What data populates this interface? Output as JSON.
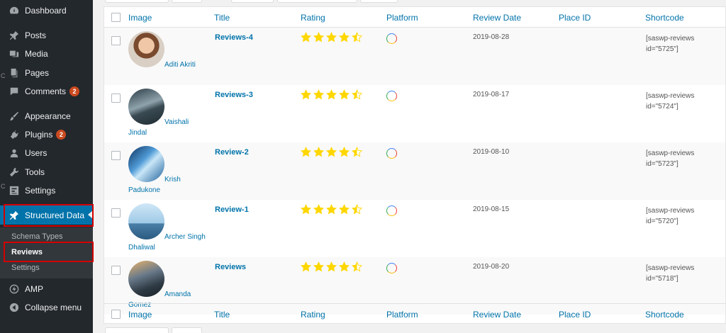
{
  "sidebar": {
    "items": [
      {
        "label": "Dashboard",
        "icon": "dashboard-icon"
      },
      {
        "label": "Posts",
        "icon": "pin-icon"
      },
      {
        "label": "Media",
        "icon": "media-icon"
      },
      {
        "label": "Pages",
        "icon": "pages-icon"
      },
      {
        "label": "Comments",
        "icon": "comments-icon",
        "badge": "2"
      },
      {
        "label": "Appearance",
        "icon": "paintbrush-icon"
      },
      {
        "label": "Plugins",
        "icon": "plugin-icon",
        "badge": "2"
      },
      {
        "label": "Users",
        "icon": "users-icon"
      },
      {
        "label": "Tools",
        "icon": "wrench-icon"
      },
      {
        "label": "Settings",
        "icon": "settings-icon"
      },
      {
        "label": "Structured Data",
        "icon": "pin-icon"
      },
      {
        "label": "AMP",
        "icon": "amp-icon"
      },
      {
        "label": "Collapse menu",
        "icon": "collapse-icon"
      }
    ],
    "submenu": [
      "Schema Types",
      "Reviews",
      "Settings"
    ]
  },
  "table": {
    "columns": [
      "Image",
      "Title",
      "Rating",
      "Platform",
      "Review Date",
      "Place ID",
      "Shortcode"
    ],
    "rows": [
      {
        "name": "Aditi Akriti",
        "title": "Reviews-4",
        "rating": 4.5,
        "date": "2019-08-28",
        "shortcode_line1": "[saswp-reviews",
        "shortcode_line2": "id=\"5725\"]",
        "place_id": ""
      },
      {
        "name": "Vaishali Jindal",
        "title": "Reviews-3",
        "rating": 4.5,
        "date": "2019-08-17",
        "shortcode_line1": "[saswp-reviews",
        "shortcode_line2": "id=\"5724\"]",
        "place_id": ""
      },
      {
        "name": "Krish Padukone",
        "title": "Review-2",
        "rating": 4.5,
        "date": "2019-08-10",
        "shortcode_line1": "[saswp-reviews",
        "shortcode_line2": "id=\"5723\"]",
        "place_id": ""
      },
      {
        "name": "Archer Singh Dhaliwal",
        "title": "Review-1",
        "rating": 4.5,
        "date": "2019-08-15",
        "shortcode_line1": "[saswp-reviews",
        "shortcode_line2": "id=\"5720\"]",
        "place_id": ""
      },
      {
        "name": "Amanda Gomez",
        "title": "Reviews",
        "rating": 4.5,
        "date": "2019-08-20",
        "shortcode_line1": "[saswp-reviews",
        "shortcode_line2": "id=\"5718\"]",
        "place_id": ""
      }
    ]
  },
  "colors": {
    "sidebar_bg": "#23282d",
    "accent": "#0073aa",
    "star": "#ffd700",
    "badge": "#ca4a1f",
    "highlight_box": "#d40000"
  }
}
